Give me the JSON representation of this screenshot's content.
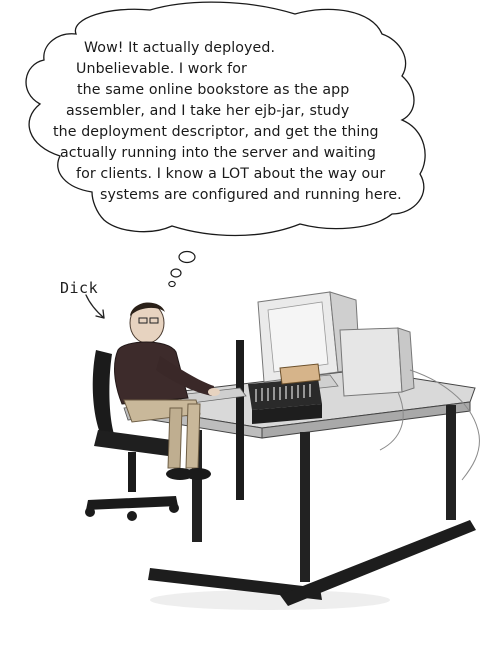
{
  "thought_bubble": {
    "lines": [
      "Wow! It actually deployed.",
      "Unbelievable. I work for",
      "the same online bookstore as the app",
      "assembler, and I take her ejb-jar, study",
      "the deployment descriptor, and get the thing",
      "actually running into the server and waiting",
      "for clients. I know a LOT about the way our",
      "systems are configured and running here."
    ]
  },
  "character": {
    "name_label": "Dick"
  }
}
